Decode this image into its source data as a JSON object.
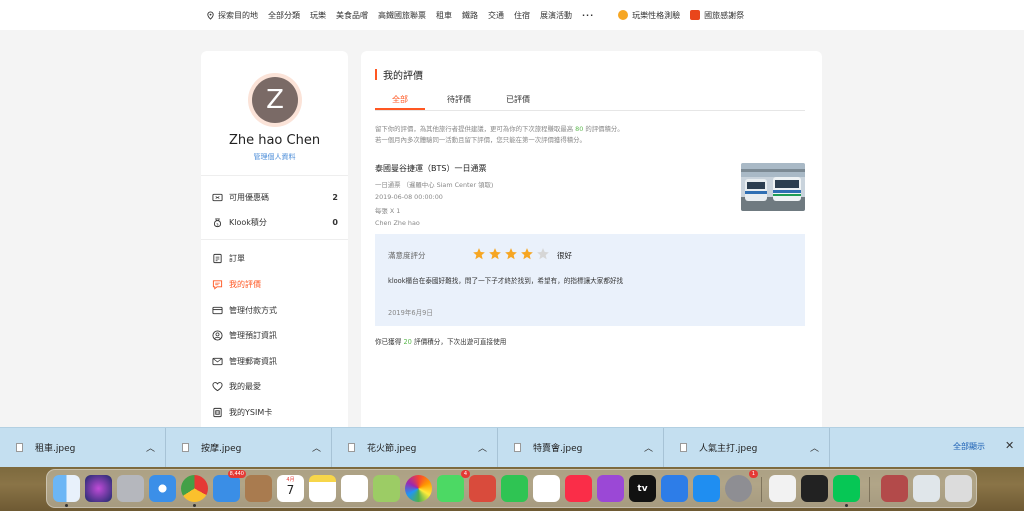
{
  "topnav": {
    "explore": "探索目的地",
    "items": [
      "全部分類",
      "玩樂",
      "美食品嚐",
      "高鐵國旅聯票",
      "租車",
      "鐵路",
      "交通",
      "住宿",
      "展演活動"
    ],
    "more": "···",
    "personality": "玩樂性格測驗",
    "thanks": "國旅感謝祭"
  },
  "profile": {
    "avatar_letter": "Z",
    "name": "Zhe hao Chen",
    "manage_link": "管理個人資料"
  },
  "sidebar": {
    "coupons_label": "可用優惠碼",
    "coupons_count": "2",
    "points_label": "Klook積分",
    "points_count": "0",
    "menu": [
      "訂單",
      "我的評價",
      "管理付款方式",
      "管理預訂資訊",
      "管理郵寄資訊",
      "我的最愛",
      "我的YSIM卡"
    ]
  },
  "main": {
    "title": "我的評價",
    "tabs": [
      "全部",
      "待評價",
      "已評價"
    ],
    "tip_line1_a": "留下你的評價，為其他旅行者提供建議，更可為你的下次旅程賺取最高",
    "tip_points": "80",
    "tip_line1_b": "的評價積分。",
    "tip_line2": "若一個月內多次體驗同一活動且留下評價，您只能在第一次評價獲得積分。",
    "product_title": "泰國曼谷捷運（BTS）一日通票",
    "product_package": "一日通票 （暹羅中心 Siam Center 領取)",
    "product_date": "2019-06-08 00:00:00",
    "product_qty": "每張 X 1",
    "product_user": "Chen Zhe hao",
    "review_label": "滿意度評分",
    "review_grade": "很好",
    "review_stars": 4,
    "review_text": "klook櫃台在泰國好難找，問了一下子才終於找到，希望有，的指標讓大家都好找",
    "review_date": "2019年6月9日",
    "earned_a": "你已獲得",
    "earned_points": "20",
    "earned_b": "評價積分，下次出遊可直接使用"
  },
  "downloads": {
    "files": [
      "租車.jpeg",
      "按摩.jpeg",
      "花火節.jpeg",
      "特賣會.jpeg",
      "人氣主打.jpeg"
    ],
    "show_all": "全部顯示",
    "close": "✕"
  },
  "dock": {
    "mail_badge": "8,440",
    "calendar_month": "4月",
    "calendar_day": "7",
    "messages_badge": "4",
    "settings_badge": "1",
    "appletv_label": "tv"
  },
  "colors": {
    "accent": "#ff5722",
    "link": "#4a8cd8",
    "points_green": "#5bb84d",
    "review_bg": "#eaf1fb",
    "star": "#f6a623"
  }
}
